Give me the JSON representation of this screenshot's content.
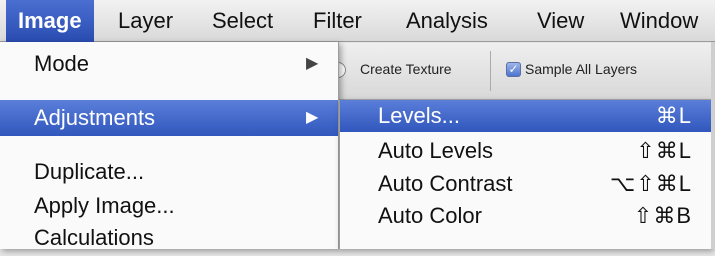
{
  "menubar": {
    "items": [
      {
        "label": "Image"
      },
      {
        "label": "Layer"
      },
      {
        "label": "Select"
      },
      {
        "label": "Filter"
      },
      {
        "label": "Analysis"
      },
      {
        "label": "View"
      },
      {
        "label": "Window"
      }
    ]
  },
  "options_bar": {
    "create_texture": "Create Texture",
    "sample_all_layers": "Sample All Layers",
    "sample_all_layers_checked": true,
    "checkmark": "✓"
  },
  "image_menu": {
    "items": [
      {
        "label": "Mode",
        "arrow": "▶"
      },
      {
        "label": "Adjustments",
        "arrow": "▶"
      },
      {
        "label": "Duplicate..."
      },
      {
        "label": "Apply Image..."
      },
      {
        "label": "Calculations"
      }
    ]
  },
  "adjustments_submenu": {
    "items": [
      {
        "label": "Levels...",
        "shortcut": "⌘L"
      },
      {
        "label": "Auto Levels",
        "shortcut": "⇧⌘L"
      },
      {
        "label": "Auto Contrast",
        "shortcut": "⌥⇧⌘L"
      },
      {
        "label": "Auto Color",
        "shortcut": "⇧⌘B"
      }
    ]
  },
  "colors": {
    "highlight": "#3a5fc4"
  }
}
